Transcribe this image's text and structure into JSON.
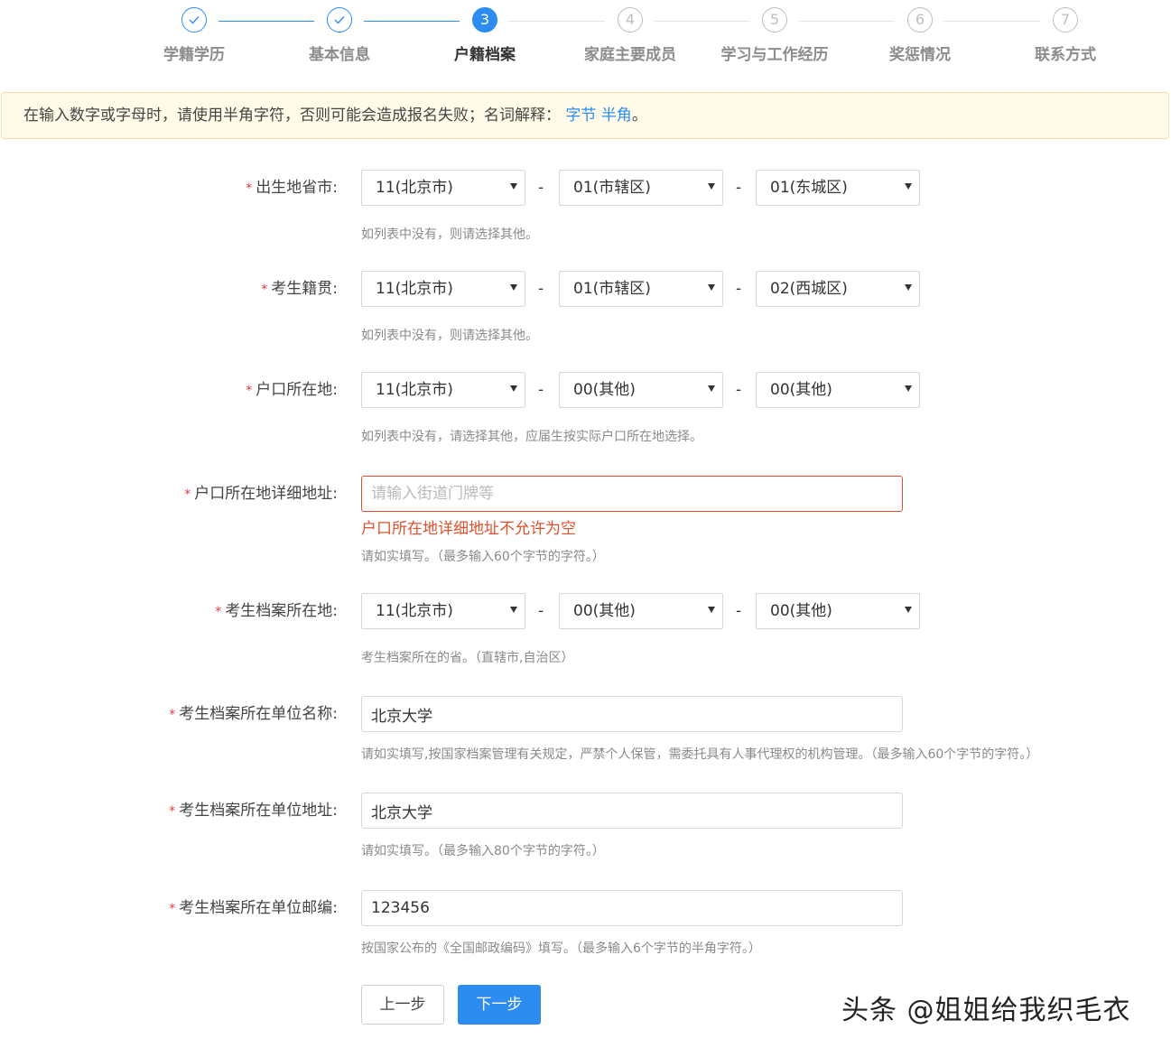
{
  "steps": [
    {
      "number": "1",
      "label": "学籍学历",
      "state": "done"
    },
    {
      "number": "2",
      "label": "基本信息",
      "state": "done"
    },
    {
      "number": "3",
      "label": "户籍档案",
      "state": "active"
    },
    {
      "number": "4",
      "label": "家庭主要成员",
      "state": "todo"
    },
    {
      "number": "5",
      "label": "学习与工作经历",
      "state": "todo"
    },
    {
      "number": "6",
      "label": "奖惩情况",
      "state": "todo"
    },
    {
      "number": "7",
      "label": "联系方式",
      "state": "todo"
    }
  ],
  "notice": {
    "text": "在输入数字或字母时，请使用半角字符，否则可能会造成报名失败；名词解释：",
    "link_byte": "字节",
    "link_halfwidth": "半角",
    "end": "。"
  },
  "form": {
    "required_mark": "*",
    "dash": "-",
    "birthplace": {
      "label": "出生地省市:",
      "province": "11(北京市)",
      "city": "01(市辖区)",
      "district": "01(东城区)",
      "hint": "如列表中没有，则请选择其他。"
    },
    "native_place": {
      "label": "考生籍贯:",
      "province": "11(北京市)",
      "city": "01(市辖区)",
      "district": "02(西城区)",
      "hint": "如列表中没有，则请选择其他。"
    },
    "hukou": {
      "label": "户口所在地:",
      "province": "11(北京市)",
      "city": "00(其他)",
      "district": "00(其他)",
      "hint": "如列表中没有，请选择其他，应届生按实际户口所在地选择。"
    },
    "hukou_address": {
      "label": "户口所在地详细地址:",
      "value": "",
      "placeholder": "请输入街道门牌等",
      "error": "户口所在地详细地址不允许为空",
      "hint": "请如实填写。（最多输入60个字节的字符。）"
    },
    "archive_location": {
      "label": "考生档案所在地:",
      "province": "11(北京市)",
      "city": "00(其他)",
      "district": "00(其他)",
      "hint": "考生档案所在的省。（直辖市,自治区）"
    },
    "archive_unit_name": {
      "label": "考生档案所在单位名称:",
      "value": "北京大学",
      "hint": "请如实填写,按国家档案管理有关规定，严禁个人保管，需委托具有人事代理权的机构管理。（最多输入60个字节的字符。）"
    },
    "archive_unit_address": {
      "label": "考生档案所在单位地址:",
      "value": "北京大学",
      "hint": "请如实填写。（最多输入80个字节的字符。）"
    },
    "archive_unit_postcode": {
      "label": "考生档案所在单位邮编:",
      "value": "123456",
      "hint": "按国家公布的《全国邮政编码》填写。（最多输入6个字节的半角字符。）"
    }
  },
  "buttons": {
    "prev": "上一步",
    "next": "下一步"
  },
  "watermark": "头条 @姐姐给我织毛衣",
  "colors": {
    "primary": "#2d8cf0",
    "error": "#e0502c",
    "notice_bg": "#fffbe8"
  }
}
